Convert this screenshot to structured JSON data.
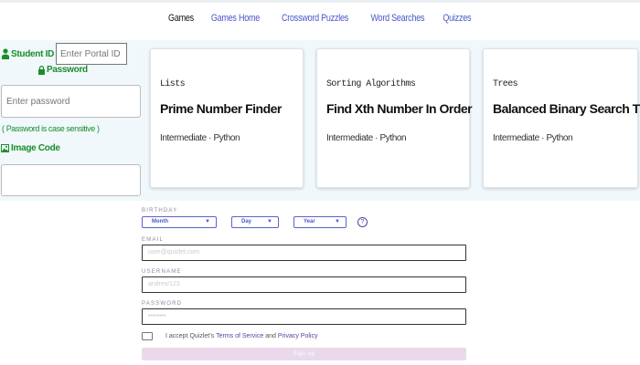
{
  "nav": {
    "items": [
      "Games",
      "Games Home",
      "Crossword Puzzles",
      "Word Searches",
      "Quizzes"
    ],
    "active": "Games"
  },
  "login": {
    "student_id_label": "Student ID",
    "student_id_placeholder": "Enter Portal ID",
    "password_label": "Password",
    "password_placeholder": "Enter password",
    "case_note": "( Password is case sensitive )",
    "image_code_label": "Image Code"
  },
  "cards": [
    {
      "category": "Lists",
      "title": "Prime Number Finder",
      "meta": "Intermediate · Python"
    },
    {
      "category": "Sorting Algorithms",
      "title": "Find Xth Number In Order",
      "meta": "Intermediate · Python"
    },
    {
      "category": "Trees",
      "title": "Balanced Binary Search Tree",
      "meta": "Intermediate · Python"
    }
  ],
  "signup": {
    "birthday_label": "BIRTHDAY",
    "month": "Month",
    "day": "Day",
    "year": "Year",
    "help": "?",
    "email_label": "EMAIL",
    "email_placeholder": "user@quizlet.com",
    "username_label": "USERNAME",
    "username_placeholder": "andrew123",
    "password_label": "PASSWORD",
    "password_placeholder": "••••••••",
    "accept_prefix": "I accept Quizlet's",
    "terms": "Terms of Service",
    "and": "and",
    "privacy": "Privacy Policy",
    "button": "Sign up"
  },
  "colors": {
    "accent": "#4a56c9",
    "green": "#1a8d2a",
    "band": "#f0f8fb"
  }
}
